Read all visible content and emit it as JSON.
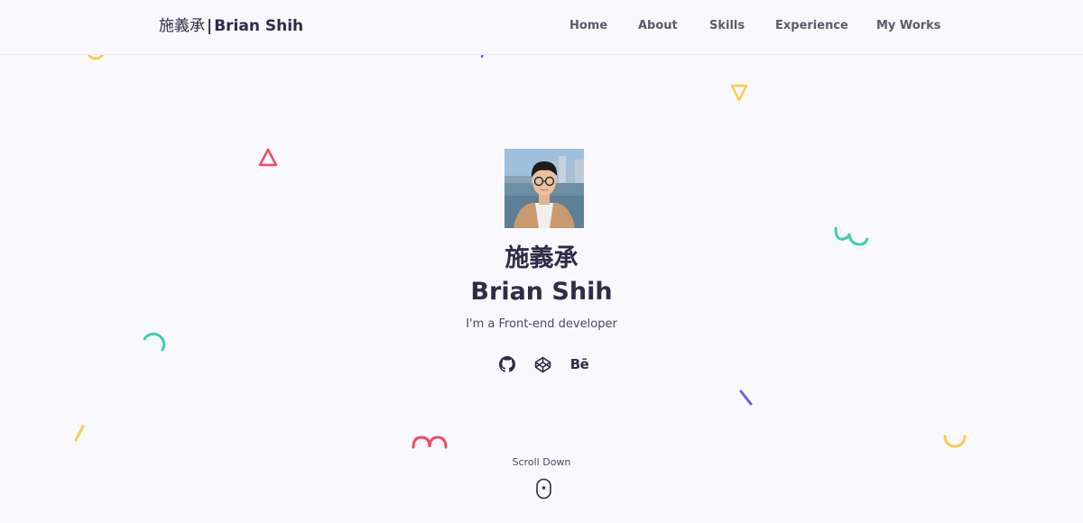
{
  "header": {
    "brand_zh": "施義承",
    "brand_sep": "|",
    "brand_en": "Brian Shih",
    "nav": [
      {
        "label": "Home"
      },
      {
        "label": "About"
      },
      {
        "label": "Skills"
      },
      {
        "label": "Experience"
      },
      {
        "label": "My Works"
      }
    ]
  },
  "hero": {
    "name_zh": "施義承",
    "name_en": "Brian Shih",
    "tagline": "I'm a Front-end developer",
    "socials": [
      {
        "icon": "github-icon"
      },
      {
        "icon": "codepen-icon"
      },
      {
        "icon": "behance-icon",
        "text": "Bē"
      }
    ],
    "scroll_label": "Scroll Down"
  },
  "colors": {
    "background": "#f9f8fd",
    "text": "#2f2c46",
    "nav_text": "#5d5b6b",
    "yellow": "#f7cf4b",
    "red": "#ef4c63",
    "teal": "#3cd0ae",
    "purple": "#6c63d6"
  }
}
